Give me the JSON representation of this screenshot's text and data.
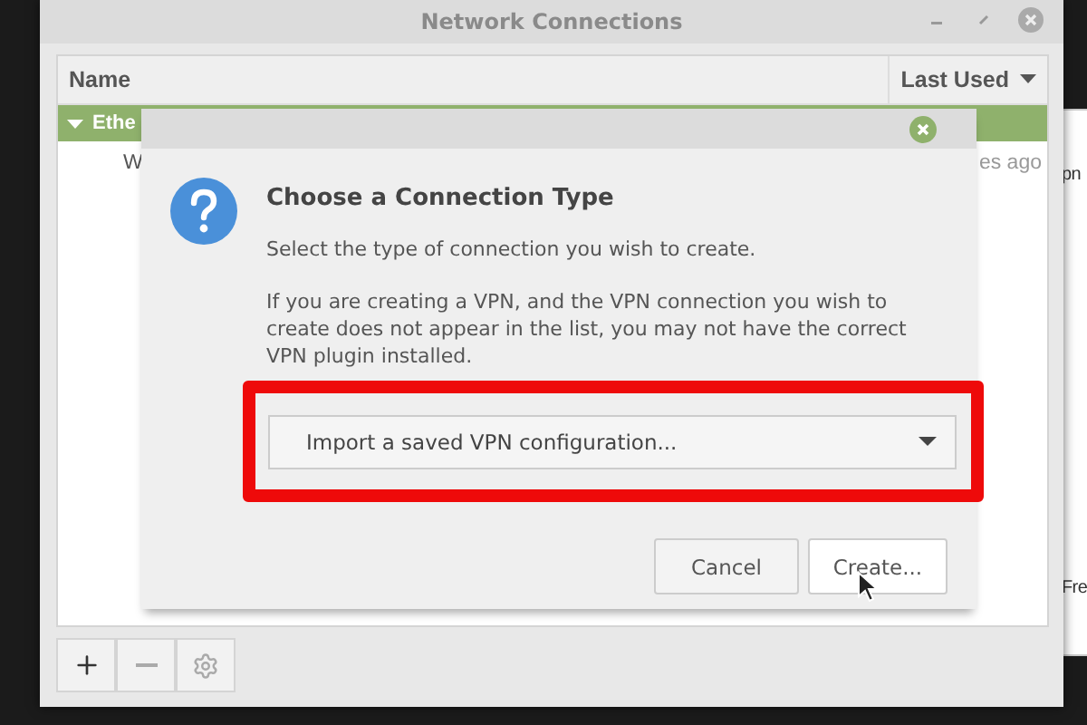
{
  "background_window": {
    "texts": [
      "pn",
      "Fre"
    ]
  },
  "window": {
    "title": "Network Connections"
  },
  "list": {
    "columns": [
      {
        "label": "Name",
        "sorted": false
      },
      {
        "label": "Last Used",
        "sorted": true
      }
    ],
    "groups": [
      {
        "label": "Ethe",
        "expanded": true,
        "selected": true,
        "rows": [
          {
            "name": "W",
            "last_used": "es ago"
          }
        ]
      }
    ]
  },
  "toolbar": [
    {
      "kind": "add",
      "disabled": false
    },
    {
      "kind": "remove",
      "disabled": true
    },
    {
      "kind": "settings",
      "disabled": true
    }
  ],
  "dialog": {
    "heading": "Choose a Connection Type",
    "text": "Select the type of connection you wish to create.",
    "note": "If you are creating a VPN, and the VPN connection you wish to create does not appear in the list, you may not have the correct VPN plugin installed.",
    "type_select": {
      "value": "Import a saved VPN configuration..."
    },
    "buttons": [
      {
        "label": "Cancel",
        "hovered": false
      },
      {
        "label": "Create...",
        "hovered": true
      }
    ]
  }
}
